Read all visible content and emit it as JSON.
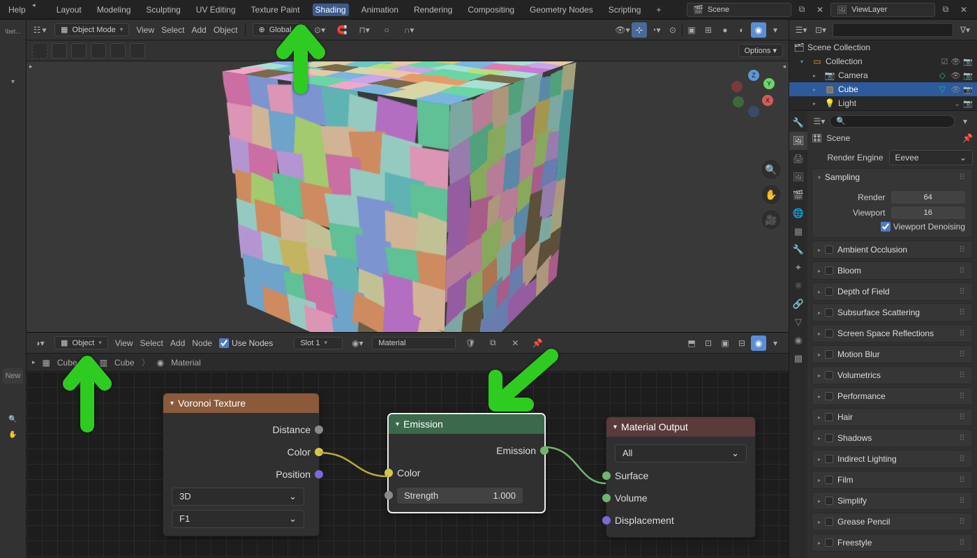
{
  "topbar": {
    "help": "Help",
    "tabs": [
      "Layout",
      "Modeling",
      "Sculpting",
      "UV Editing",
      "Texture Paint",
      "Shading",
      "Animation",
      "Rendering",
      "Compositing",
      "Geometry Nodes",
      "Scripting"
    ],
    "active_tab": "Shading",
    "scene_label": "Scene",
    "viewlayer_label": "ViewLayer"
  },
  "left_strip": {
    "beta": "\\bet...",
    "new": "New"
  },
  "viewport_header": {
    "mode": "Object Mode",
    "menus": [
      "View",
      "Select",
      "Add",
      "Object"
    ],
    "orientation": "Global",
    "options": "Options"
  },
  "outliner": {
    "search_placeholder": "",
    "root": "Scene Collection",
    "collection": "Collection",
    "items": [
      {
        "name": "Camera",
        "icon": "📷"
      },
      {
        "name": "Cube",
        "icon": "▨",
        "selected": true
      },
      {
        "name": "Light",
        "icon": "💡"
      }
    ]
  },
  "props": {
    "search_placeholder": "🔍",
    "title_icon": "🎛",
    "title": "Scene",
    "render_engine_lbl": "Render Engine",
    "render_engine_val": "Eevee",
    "sampling": {
      "title": "Sampling",
      "render_lbl": "Render",
      "render": "64",
      "viewport_lbl": "Viewport",
      "viewport": "16",
      "denoise": "Viewport Denoising"
    },
    "panels": [
      "Ambient Occlusion",
      "Bloom",
      "Depth of Field",
      "Subsurface Scattering",
      "Screen Space Reflections",
      "Motion Blur",
      "Volumetrics",
      "Performance",
      "Hair",
      "Shadows",
      "Indirect Lighting",
      "Film",
      "Simplify",
      "Grease Pencil",
      "Freestyle"
    ]
  },
  "node_editor": {
    "header": {
      "mode": "Object",
      "menus": [
        "View",
        "Select",
        "Add",
        "Node"
      ],
      "use_nodes": "Use Nodes",
      "slot": "Slot 1",
      "material": "Material"
    },
    "breadcrumb": [
      "Cube",
      "Cube",
      "Material"
    ],
    "voronoi": {
      "title": "Voronoi Texture",
      "outs": [
        "Distance",
        "Color",
        "Position"
      ],
      "select_3d": "3D",
      "select_f1": "F1"
    },
    "emission": {
      "title": "Emission",
      "out": "Emission",
      "in_color": "Color",
      "strength_lbl": "Strength",
      "strength_val": "1.000"
    },
    "output": {
      "title": "Material Output",
      "all": "All",
      "surface": "Surface",
      "volume": "Volume",
      "displacement": "Displacement"
    }
  },
  "gizmo": {
    "x": "X",
    "y": "Y",
    "z": "Z"
  }
}
